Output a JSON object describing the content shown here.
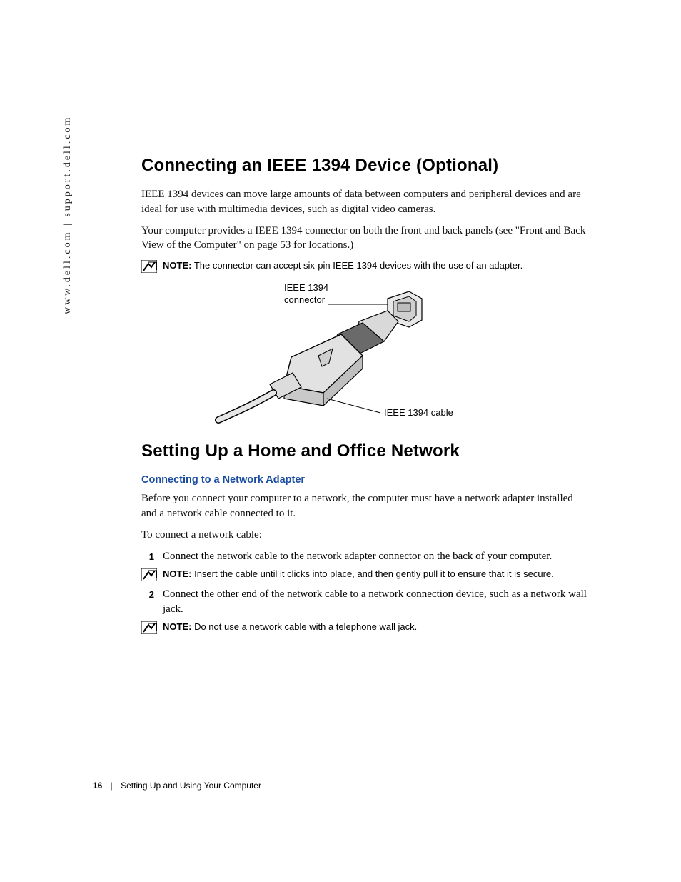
{
  "side_url": "www.dell.com | support.dell.com",
  "section1": {
    "title": "Connecting an IEEE 1394 Device (Optional)",
    "p1": "IEEE 1394 devices can move large amounts of data between computers and peripheral devices and are ideal for use with multimedia devices, such as digital video cameras.",
    "p2": "Your computer provides a IEEE 1394 connector on both the front and back panels (see \"Front and Back View of the Computer\" on page 53 for locations.)",
    "note_label": "NOTE:",
    "note_text": "The connector can accept six-pin IEEE 1394 devices with the use of an adapter.",
    "fig_label_connector_l1": "IEEE 1394",
    "fig_label_connector_l2": "connector",
    "fig_label_cable": "IEEE 1394 cable"
  },
  "section2": {
    "title": "Setting Up a Home and Office Network",
    "sub": "Connecting to a Network Adapter",
    "p1": "Before you connect your computer to a network, the computer must have a network adapter installed and a network cable connected to it.",
    "p2": "To connect a network cable:",
    "steps": [
      {
        "num": "1",
        "text": "Connect the network cable to the network adapter connector on the back of your computer."
      },
      {
        "num": "2",
        "text": "Connect the other end of the network cable to a network connection device, such as a network wall jack."
      }
    ],
    "note1_label": "NOTE:",
    "note1_text": "Insert the cable until it clicks into place, and then gently pull it to ensure that it is secure.",
    "note2_label": "NOTE:",
    "note2_text": "Do not use a network cable with a telephone wall jack."
  },
  "footer": {
    "page": "16",
    "chapter": "Setting Up and Using Your Computer"
  }
}
